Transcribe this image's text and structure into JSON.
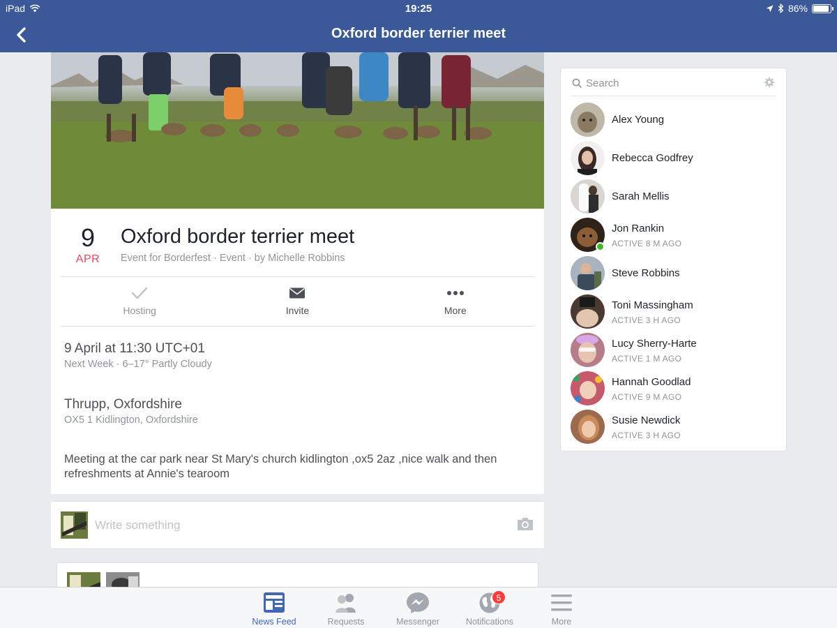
{
  "status_bar": {
    "device": "iPad",
    "time": "19:25",
    "battery": "86%"
  },
  "nav": {
    "title": "Oxford border terrier meet"
  },
  "event": {
    "day": "9",
    "month": "APR",
    "title": "Oxford border terrier meet",
    "subtitle": "Event for Borderfest · Event · by Michelle Robbins",
    "actions": [
      {
        "label": "Hosting",
        "icon": "check-icon"
      },
      {
        "label": "Invite",
        "icon": "envelope-icon"
      },
      {
        "label": "More",
        "icon": "ellipsis-icon"
      }
    ],
    "when": {
      "main": "9 April at 11:30 UTC+01",
      "sub": "Next Week · 6–17° Partly Cloudy"
    },
    "where": {
      "main": "Thrupp, Oxfordshire",
      "sub": "OX5 1 Kidlington, Oxfordshire"
    },
    "description": "Meeting at the car park near St Mary's church kidlington ,ox5 2az ,nice walk and then refreshments at Annie's tearoom"
  },
  "composer": {
    "placeholder": "Write something"
  },
  "sidebar": {
    "search_placeholder": "Search",
    "friends": [
      {
        "name": "Alex Young",
        "status": "",
        "online": false,
        "color": "#8a7a63"
      },
      {
        "name": "Rebecca Godfrey",
        "status": "",
        "online": false,
        "color": "#3a2a26"
      },
      {
        "name": "Sarah Mellis",
        "status": "",
        "online": false,
        "color": "#d9d6d1"
      },
      {
        "name": "Jon Rankin",
        "status": "ACTIVE 8 M AGO",
        "online": true,
        "color": "#6b4a2e"
      },
      {
        "name": "Steve Robbins",
        "status": "",
        "online": false,
        "color": "#7a8694"
      },
      {
        "name": "Toni Massingham",
        "status": "ACTIVE 3 H AGO",
        "online": false,
        "color": "#4b3a33"
      },
      {
        "name": "Lucy Sherry-Harte",
        "status": "ACTIVE 1 M AGO",
        "online": false,
        "color": "#b57d8a"
      },
      {
        "name": "Hannah Goodlad",
        "status": "ACTIVE 9 M AGO",
        "online": false,
        "color": "#c55a6c"
      },
      {
        "name": "Susie Newdick",
        "status": "ACTIVE 3 H AGO",
        "online": false,
        "color": "#9b6a4f"
      }
    ]
  },
  "tabs": [
    {
      "label": "News Feed",
      "icon": "news-feed-icon",
      "active": true
    },
    {
      "label": "Requests",
      "icon": "friend-requests-icon",
      "active": false
    },
    {
      "label": "Messenger",
      "icon": "messenger-icon",
      "active": false
    },
    {
      "label": "Notifications",
      "icon": "globe-icon",
      "active": false,
      "badge": "5"
    },
    {
      "label": "More",
      "icon": "hamburger-menu-icon",
      "active": false
    }
  ],
  "colors": {
    "brand": "#3b5998",
    "accent": "#4267b2",
    "date_month": "#e0475c",
    "online": "#42b72a",
    "badge": "#fa3e3e"
  }
}
